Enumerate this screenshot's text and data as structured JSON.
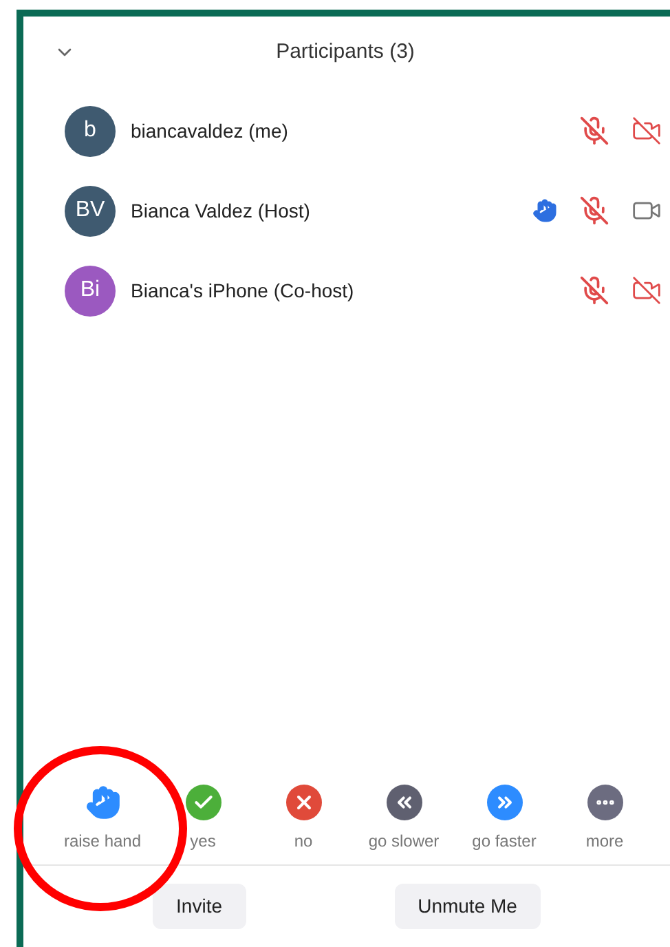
{
  "header": {
    "title": "Participants (3)"
  },
  "participants": [
    {
      "initials": "b",
      "name": "biancavaldez (me)",
      "color": "#3f5a70",
      "hand_raised": false,
      "muted": true,
      "video_on": false
    },
    {
      "initials": "BV",
      "name": "Bianca Valdez (Host)",
      "color": "#3f5a70",
      "hand_raised": true,
      "muted": true,
      "video_on": true
    },
    {
      "initials": "Bi",
      "name": "Bianca's iPhone (Co-host)",
      "color": "#9b59c0",
      "hand_raised": false,
      "muted": true,
      "video_on": false
    }
  ],
  "reactions": [
    {
      "kind": "hand",
      "label": "raise hand"
    },
    {
      "kind": "yes",
      "label": "yes"
    },
    {
      "kind": "no",
      "label": "no"
    },
    {
      "kind": "slower",
      "label": "go slower"
    },
    {
      "kind": "faster",
      "label": "go faster"
    },
    {
      "kind": "more",
      "label": "more"
    }
  ],
  "buttons": [
    "Invite",
    "Unmute Me"
  ]
}
